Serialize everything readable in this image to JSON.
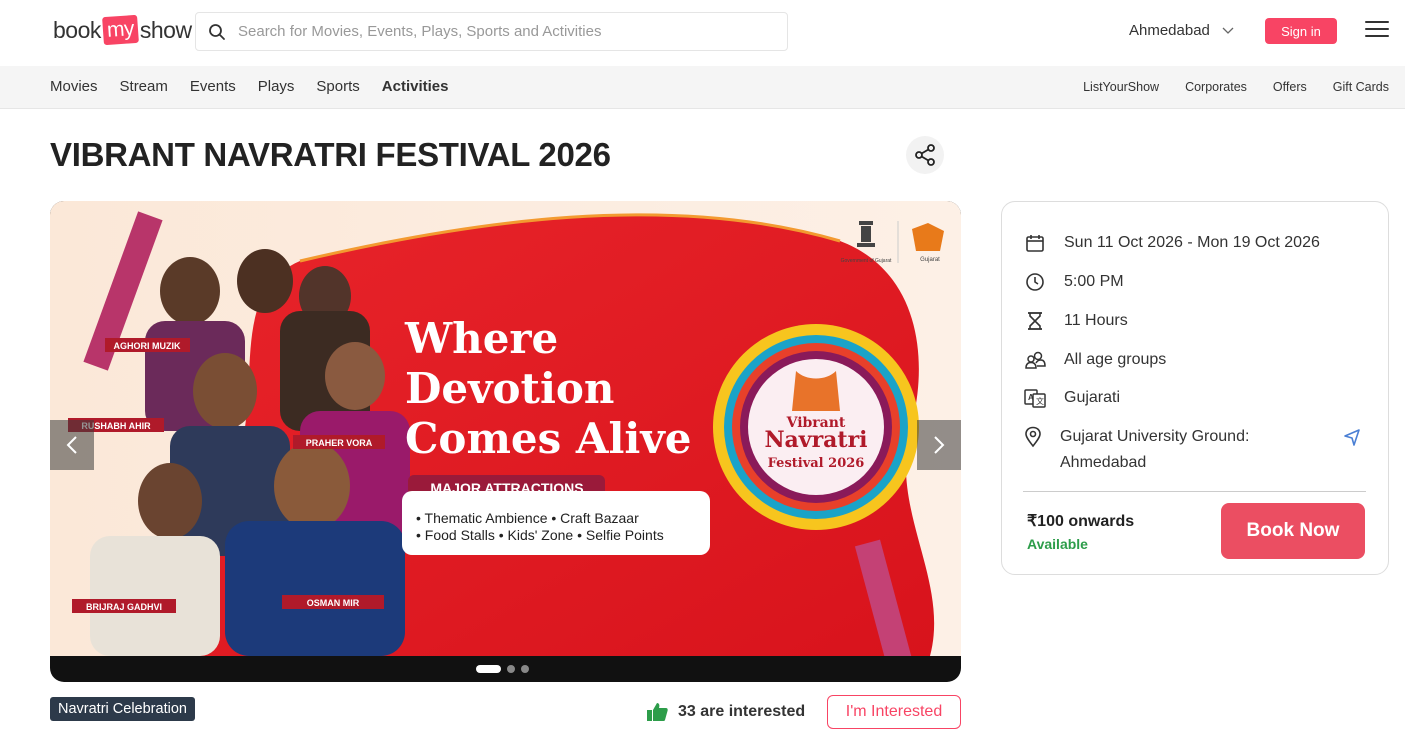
{
  "header": {
    "logo": {
      "prefix": "book",
      "highlight": "my",
      "suffix": "show"
    },
    "search_placeholder": "Search for Movies, Events, Plays, Sports and Activities",
    "city": "Ahmedabad",
    "signin_label": "Sign in"
  },
  "nav": {
    "left": [
      "Movies",
      "Stream",
      "Events",
      "Plays",
      "Sports",
      "Activities"
    ],
    "active": "Activities",
    "right": [
      "ListYourShow",
      "Corporates",
      "Offers",
      "Gift Cards"
    ]
  },
  "event": {
    "title": "VIBRANT NAVRATRI FESTIVAL 2026",
    "tag": "Navratri Celebration",
    "interested_count": "33 are interested",
    "interested_button": "I'm Interested"
  },
  "banner": {
    "headline": [
      "Where",
      "Devotion",
      "Comes Alive"
    ],
    "attractions_title": "MAJOR ATTRACTIONS",
    "attractions": [
      "• Thematic Ambience • Craft Bazaar",
      "• Food Stalls • Kids' Zone • Selfie Points"
    ],
    "artists": [
      "AGHORI MUZIK",
      "RUSHABH AHIR",
      "PRAHER VORA",
      "BRIJRAJ GADHVI",
      "OSMAN MIR"
    ],
    "badge_top": "Vibrant",
    "badge_mid": "Navratri",
    "badge_bottom": "Festival 2026",
    "gov_label": "Government of Gujarat",
    "tourism_label": "Gujarat",
    "slides_total": 3,
    "slide_active": 1
  },
  "details": {
    "date": "Sun 11 Oct 2026 - Mon 19 Oct 2026",
    "time": "5:00 PM",
    "duration": "11 Hours",
    "age": "All age groups",
    "language": "Gujarati",
    "venue": "Gujarat University Ground: Ahmedabad",
    "price": "₹100 onwards",
    "availability": "Available",
    "book_label": "Book Now"
  },
  "colors": {
    "brand": "#f84464",
    "book": "#eb4e62",
    "available": "#2d9d4a"
  }
}
